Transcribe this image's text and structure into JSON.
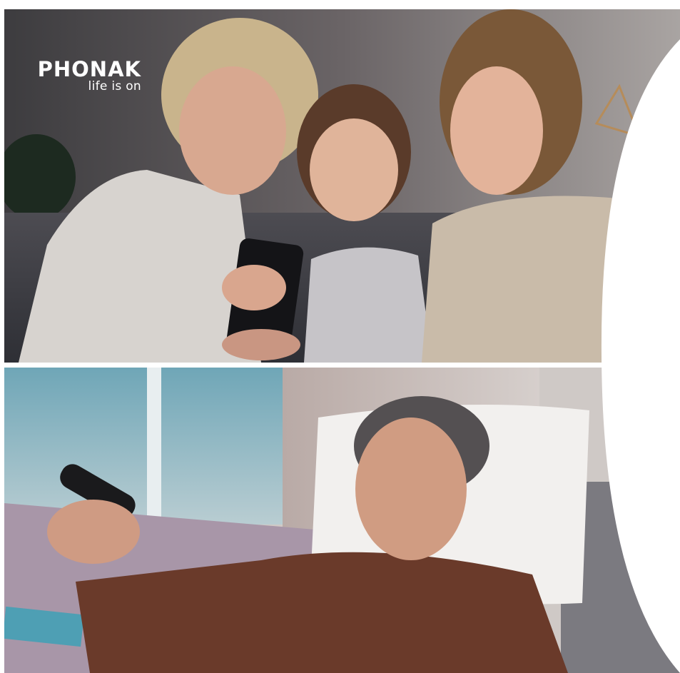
{
  "brand": {
    "name": "PHONAK",
    "tagline": "life is on"
  },
  "photos": [
    {
      "id": "family-photo",
      "subject": "grandmother, girl and mother laughing at a phone on a sofa"
    },
    {
      "id": "man-photo",
      "subject": "smiling man on a sofa pointing a remote control"
    }
  ],
  "colors": {
    "background": "#ffffff",
    "logo": "#ffffff",
    "top_photo_tone": "#5a5558",
    "bottom_photo_tone": "#8d8a8c"
  }
}
